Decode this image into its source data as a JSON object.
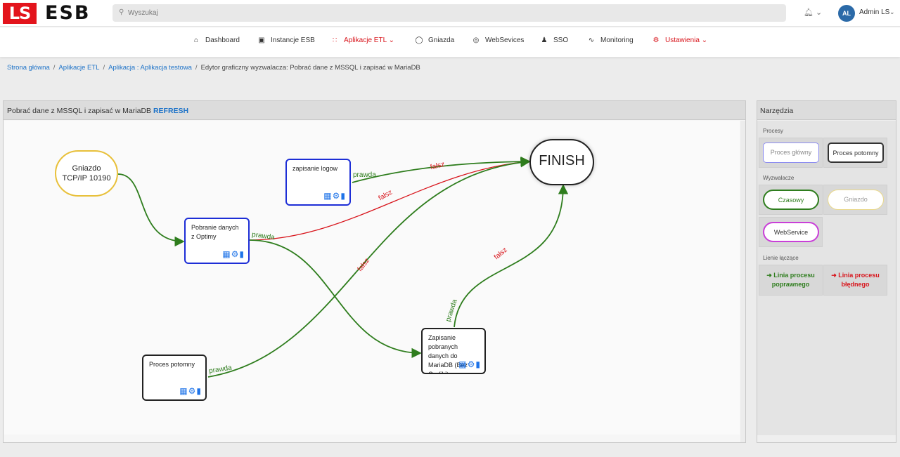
{
  "logo": {
    "mark": "LS",
    "name": "ESB"
  },
  "search": {
    "placeholder": "Wyszukaj"
  },
  "user": {
    "initials": "AL",
    "name": "Admin LS"
  },
  "nav": [
    {
      "label": "Dashboard",
      "icon": "home-icon"
    },
    {
      "label": "Instancje ESB",
      "icon": "server-icon"
    },
    {
      "label": "Aplikacje ETL",
      "icon": "grid-icon",
      "active": true
    },
    {
      "label": "Gniazda",
      "icon": "socket-icon"
    },
    {
      "label": "WebSevices",
      "icon": "globe-icon"
    },
    {
      "label": "SSO",
      "icon": "users-icon"
    },
    {
      "label": "Monitoring",
      "icon": "pulse-icon"
    },
    {
      "label": "Ustawienia",
      "icon": "gear-icon",
      "active": true
    }
  ],
  "breadcrumb": {
    "home": "Strona główna",
    "etl": "Aplikacje ETL",
    "app": "Aplikacja : Aplikacja testowa",
    "current": "Edytor graficzny wyzwalacza: Pobrać dane z MSSQL i zapisać w MariaDB"
  },
  "editor": {
    "title": "Pobrać dane z MSSQL i zapisać w MariaDB",
    "refresh": "REFRESH"
  },
  "diagram": {
    "socket": {
      "line1": "Gniazdo",
      "line2": "TCP/IP 10190"
    },
    "finish": "FINISH",
    "nodes": {
      "logging": "zapisanie logow",
      "fetch": "Pobranie danych z Optimy",
      "save": "Zapisanie pobranych danych do MariaDB (Bez Grafiki)",
      "child": "Proces potomny"
    },
    "labels": {
      "true": "prawda",
      "false": "fałsz"
    },
    "colors": {
      "success": "#2e7d1d",
      "error": "#d8141b",
      "node_border": "#1d2ed6",
      "socket": "#e8c03a"
    }
  },
  "tools": {
    "title": "Narzędzia",
    "processes": {
      "heading": "Procesy",
      "main": "Proces główny",
      "child": "Proces potomny"
    },
    "triggers": {
      "heading": "Wyzwalacze",
      "timer": "Czasowy",
      "socket": "Gniazdo",
      "webservice": "WebService"
    },
    "lines": {
      "heading": "Lienie łączące",
      "correct": "Linia procesu poprawnego",
      "error": "Linia procesu błędnego"
    }
  }
}
